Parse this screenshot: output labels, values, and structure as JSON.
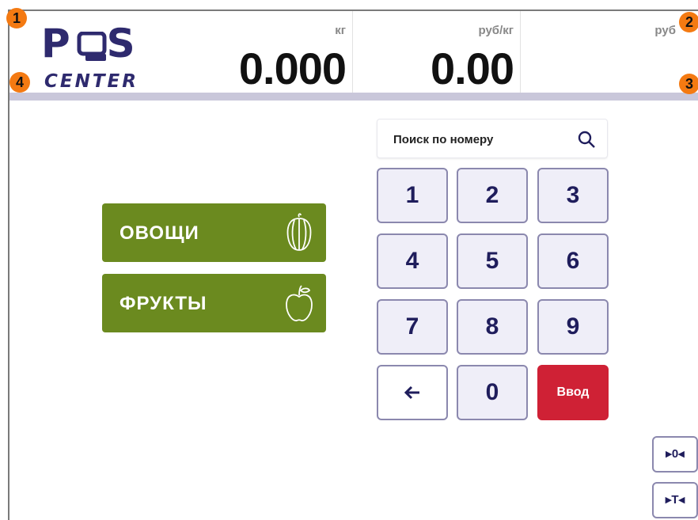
{
  "logo": {
    "top": "P S",
    "bottom": "CENTER"
  },
  "header": {
    "weight": {
      "unit": "кг",
      "value": "0.000"
    },
    "price_per_kg": {
      "unit": "руб/кг",
      "value": "0.00"
    },
    "total": {
      "unit": "руб",
      "value": ""
    }
  },
  "markers": [
    "1",
    "2",
    "3",
    "4"
  ],
  "categories": [
    {
      "label": "ОВОЩИ",
      "icon": "pepper-icon"
    },
    {
      "label": "ФРУКТЫ",
      "icon": "apple-icon"
    }
  ],
  "search": {
    "placeholder": "Поиск по номеру",
    "icon": "search-icon"
  },
  "keypad": {
    "keys": [
      "1",
      "2",
      "3",
      "4",
      "5",
      "6",
      "7",
      "8",
      "9"
    ],
    "back_icon": "arrow-left-icon",
    "zero": "0",
    "enter": "Ввод"
  },
  "side_buttons": {
    "zero": "▸0◂",
    "tare": "▸T◂"
  },
  "colors": {
    "brand": "#2e2a6e",
    "category": "#6b8a1f",
    "enter": "#cf2135",
    "marker": "#f47a12"
  }
}
